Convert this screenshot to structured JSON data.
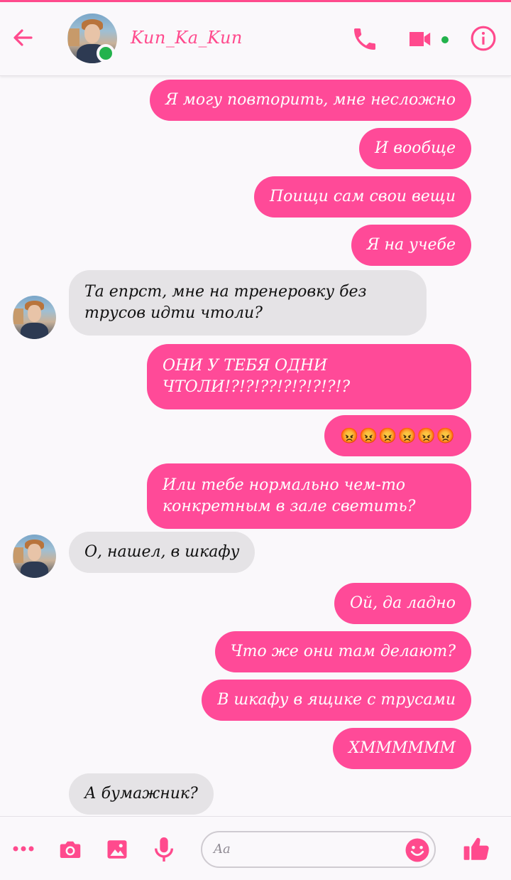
{
  "header": {
    "contact_name": "Kun_Ka_Kun",
    "online": true,
    "icons": [
      "back-arrow-icon",
      "phone-icon",
      "video-camera-icon",
      "info-icon"
    ]
  },
  "messages": [
    {
      "side": "out",
      "text": "Я могу повторить, мне несложно"
    },
    {
      "side": "out",
      "text": "И вообще"
    },
    {
      "side": "out",
      "text": "Поищи сам свои вещи"
    },
    {
      "side": "out",
      "text": "Я на учебе"
    },
    {
      "side": "in",
      "text": "Та епрст, мне на тренеровку без\nтрусов идти чтоли?"
    },
    {
      "side": "out",
      "text": "ОНИ У ТЕБЯ ОДНИ\nЧТОЛИ!?!?!??!?!?!?!?!?"
    },
    {
      "side": "out",
      "text": "😡😡😡😡😡😡"
    },
    {
      "side": "out",
      "text": "Или тебе нормально чем-то\nконкретным в зале светить?"
    },
    {
      "side": "in",
      "text": "О, нашел, в шкафу"
    },
    {
      "side": "out",
      "text": "Ой, да ладно"
    },
    {
      "side": "out",
      "text": "Что же они там делают?"
    },
    {
      "side": "out",
      "text": "В шкафу в ящике с трусами"
    },
    {
      "side": "out",
      "text": "ХММММММ"
    },
    {
      "side": "in",
      "text": "А бумажник?"
    }
  ],
  "composer": {
    "placeholder": "Aa",
    "icons": [
      "more-icon",
      "camera-icon",
      "image-icon",
      "microphone-icon",
      "emoji-icon",
      "thumbs-up-icon"
    ]
  },
  "colors": {
    "accent": "#ff4a8d",
    "outgoing_bubble": "#ff4a98",
    "incoming_bubble": "#e5e3e6",
    "online": "#22b24c"
  }
}
